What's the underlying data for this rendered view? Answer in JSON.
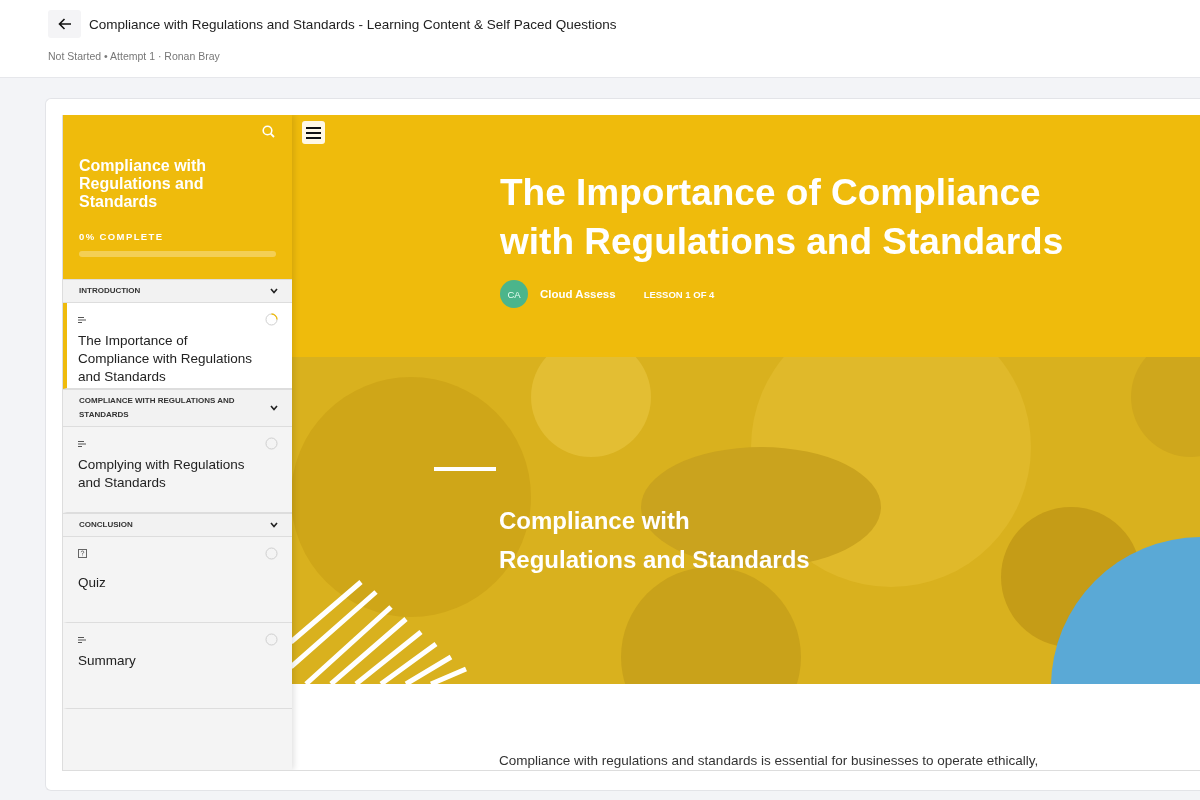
{
  "header": {
    "title": "Compliance with Regulations and Standards - Learning Content & Self Paced Questions",
    "subtitle": "Not Started • Attempt 1 · Ronan Bray"
  },
  "sidebar": {
    "course_title": "Compliance with Regulations and Standards",
    "progress_label": "0% COMPLETE",
    "progress": {
      "level": 0
    },
    "sections": [
      {
        "title": "INTRODUCTION",
        "expanded": true,
        "lessons": [
          {
            "kind": "text",
            "title": "The Importance of Compliance with Regulations and Standards",
            "selected": true,
            "in_progress": true
          }
        ]
      },
      {
        "title": "COMPLIANCE WITH REGULATIONS AND STANDARDS",
        "expanded": true,
        "lessons": [
          {
            "kind": "text",
            "title": "Complying with Regulations and Standards",
            "selected": false,
            "in_progress": false
          }
        ]
      },
      {
        "title": "CONCLUSION",
        "expanded": true,
        "lessons": [
          {
            "kind": "quiz",
            "title": "Quiz",
            "selected": false,
            "in_progress": false
          },
          {
            "kind": "text",
            "title": "Summary",
            "selected": false,
            "in_progress": false
          }
        ]
      }
    ]
  },
  "lesson": {
    "title": "The Importance of Compliance with Regulations and Standards",
    "author_initials": "CA",
    "author": "Cloud Assess",
    "counter": "LESSON 1 OF 4",
    "banner": {
      "kind": "picture",
      "heading_lines": [
        "Compliance with",
        "Regulations and Standards"
      ]
    },
    "body": "Compliance with regulations and standards is essential for businesses to operate ethically,"
  }
}
